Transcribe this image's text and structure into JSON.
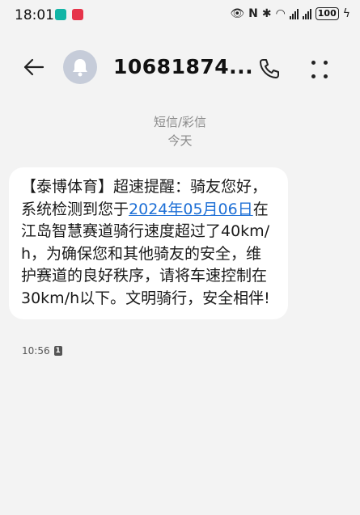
{
  "status_bar": {
    "time": "18:01",
    "battery": "100",
    "app_badge1_color": "#13b5a6",
    "app_badge2_color": "#e6344a"
  },
  "header": {
    "title": "10681874...",
    "back_icon": "arrow-left-icon",
    "call_icon": "phone-icon",
    "more_icon": "more-dots-icon"
  },
  "thread": {
    "channel": "短信/彩信",
    "date": "今天"
  },
  "message": {
    "text_before": "【泰博体育】超速提醒：骑友您好，系统检测到您于",
    "date_link": "2024年05月06日",
    "text_after": "在江岛智慧赛道骑行速度超过了40km/h，为确保您和其他骑友的安全，维护赛道的良好秩序，请将车速控制在30km/h以下。文明骑行，安全相伴!",
    "time": "10:56",
    "sim": "1",
    "link_color": "#1d6fd6"
  }
}
